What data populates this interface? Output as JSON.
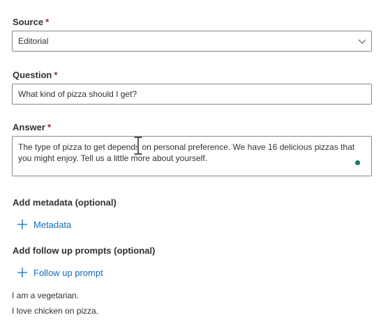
{
  "source": {
    "label": "Source",
    "required_mark": "*",
    "value": "Editorial"
  },
  "question": {
    "label": "Question",
    "required_mark": "*",
    "value": "What kind of pizza should I get?"
  },
  "answer": {
    "label": "Answer",
    "required_mark": "*",
    "value": "The type of pizza to get depends on personal preference. We have 16 delicious pizzas that you might enjoy. Tell us a little more about yourself."
  },
  "metadata": {
    "heading": "Add metadata (optional)",
    "add_label": "Metadata"
  },
  "follow_up": {
    "heading": "Add follow up prompts (optional)",
    "add_label": "Follow up prompt",
    "prompts": [
      "I am a vegetarian.",
      "I love chicken on pizza."
    ]
  },
  "colors": {
    "accent": "#0f6cbd",
    "required": "#a4262c",
    "status_dot": "#0b7b6a"
  }
}
